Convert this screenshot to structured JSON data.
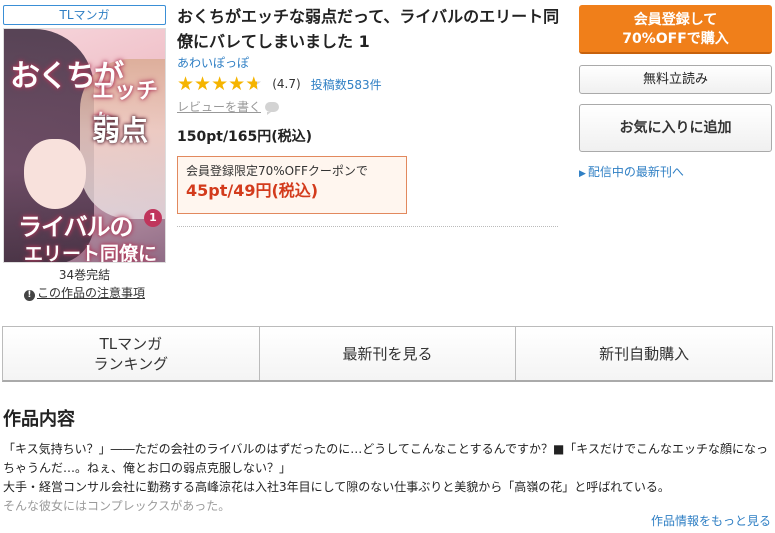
{
  "genre_tag": "TLマンガ",
  "book": {
    "title": "おくちがエッチな弱点だって、ライバルのエリート同僚にバレてしまいました 1",
    "author": "あわいぽっぽ",
    "rating_value": "(4.7)",
    "rating": 4.7,
    "review_count": "投稿数583件",
    "write_review": "レビューを書く",
    "price": "150pt/165円(税込)",
    "coupon_label": "会員登録限定70%OFFクーポンで",
    "coupon_price": "45pt/49円(税込)",
    "volumes": "34巻完結",
    "notice": "この作品の注意事項"
  },
  "cover": {
    "title_1": "おくちが",
    "title_2": "エッチな",
    "title_3": "弱点",
    "title_4": "ライバルの",
    "title_5": "エリート同僚に",
    "volume_badge": "1"
  },
  "actions": {
    "register_line1": "会員登録して",
    "register_line2": "70%OFFで購入",
    "free_read": "無料立読み",
    "favorite": "お気に入りに追加",
    "latest_link": "配信中の最新刊へ"
  },
  "tabs": [
    {
      "line1": "TLマンガ",
      "line2": "ランキング"
    },
    {
      "line1": "最新刊を見る",
      "line2": ""
    },
    {
      "line1": "新刊自動購入",
      "line2": ""
    }
  ],
  "description": {
    "heading": "作品内容",
    "line_1": "「キス気持ちい？」――ただの会社のライバルのはずだったのに…どうしてこんなことするんですか？■「キスだけでこんなエッチな顔になっちゃうんだ…。ねぇ、俺とお口の弱点克服しない？」",
    "line_2": "大手・経営コンサル会社に勤務する高峰涼花は入社3年目にして隙のない仕事ぶりと美貌から「高嶺の花」と呼ばれている。",
    "line_3": "そんな彼女にはコンプレックスがあった。",
    "more_link": "作品情報をもっと見る"
  }
}
